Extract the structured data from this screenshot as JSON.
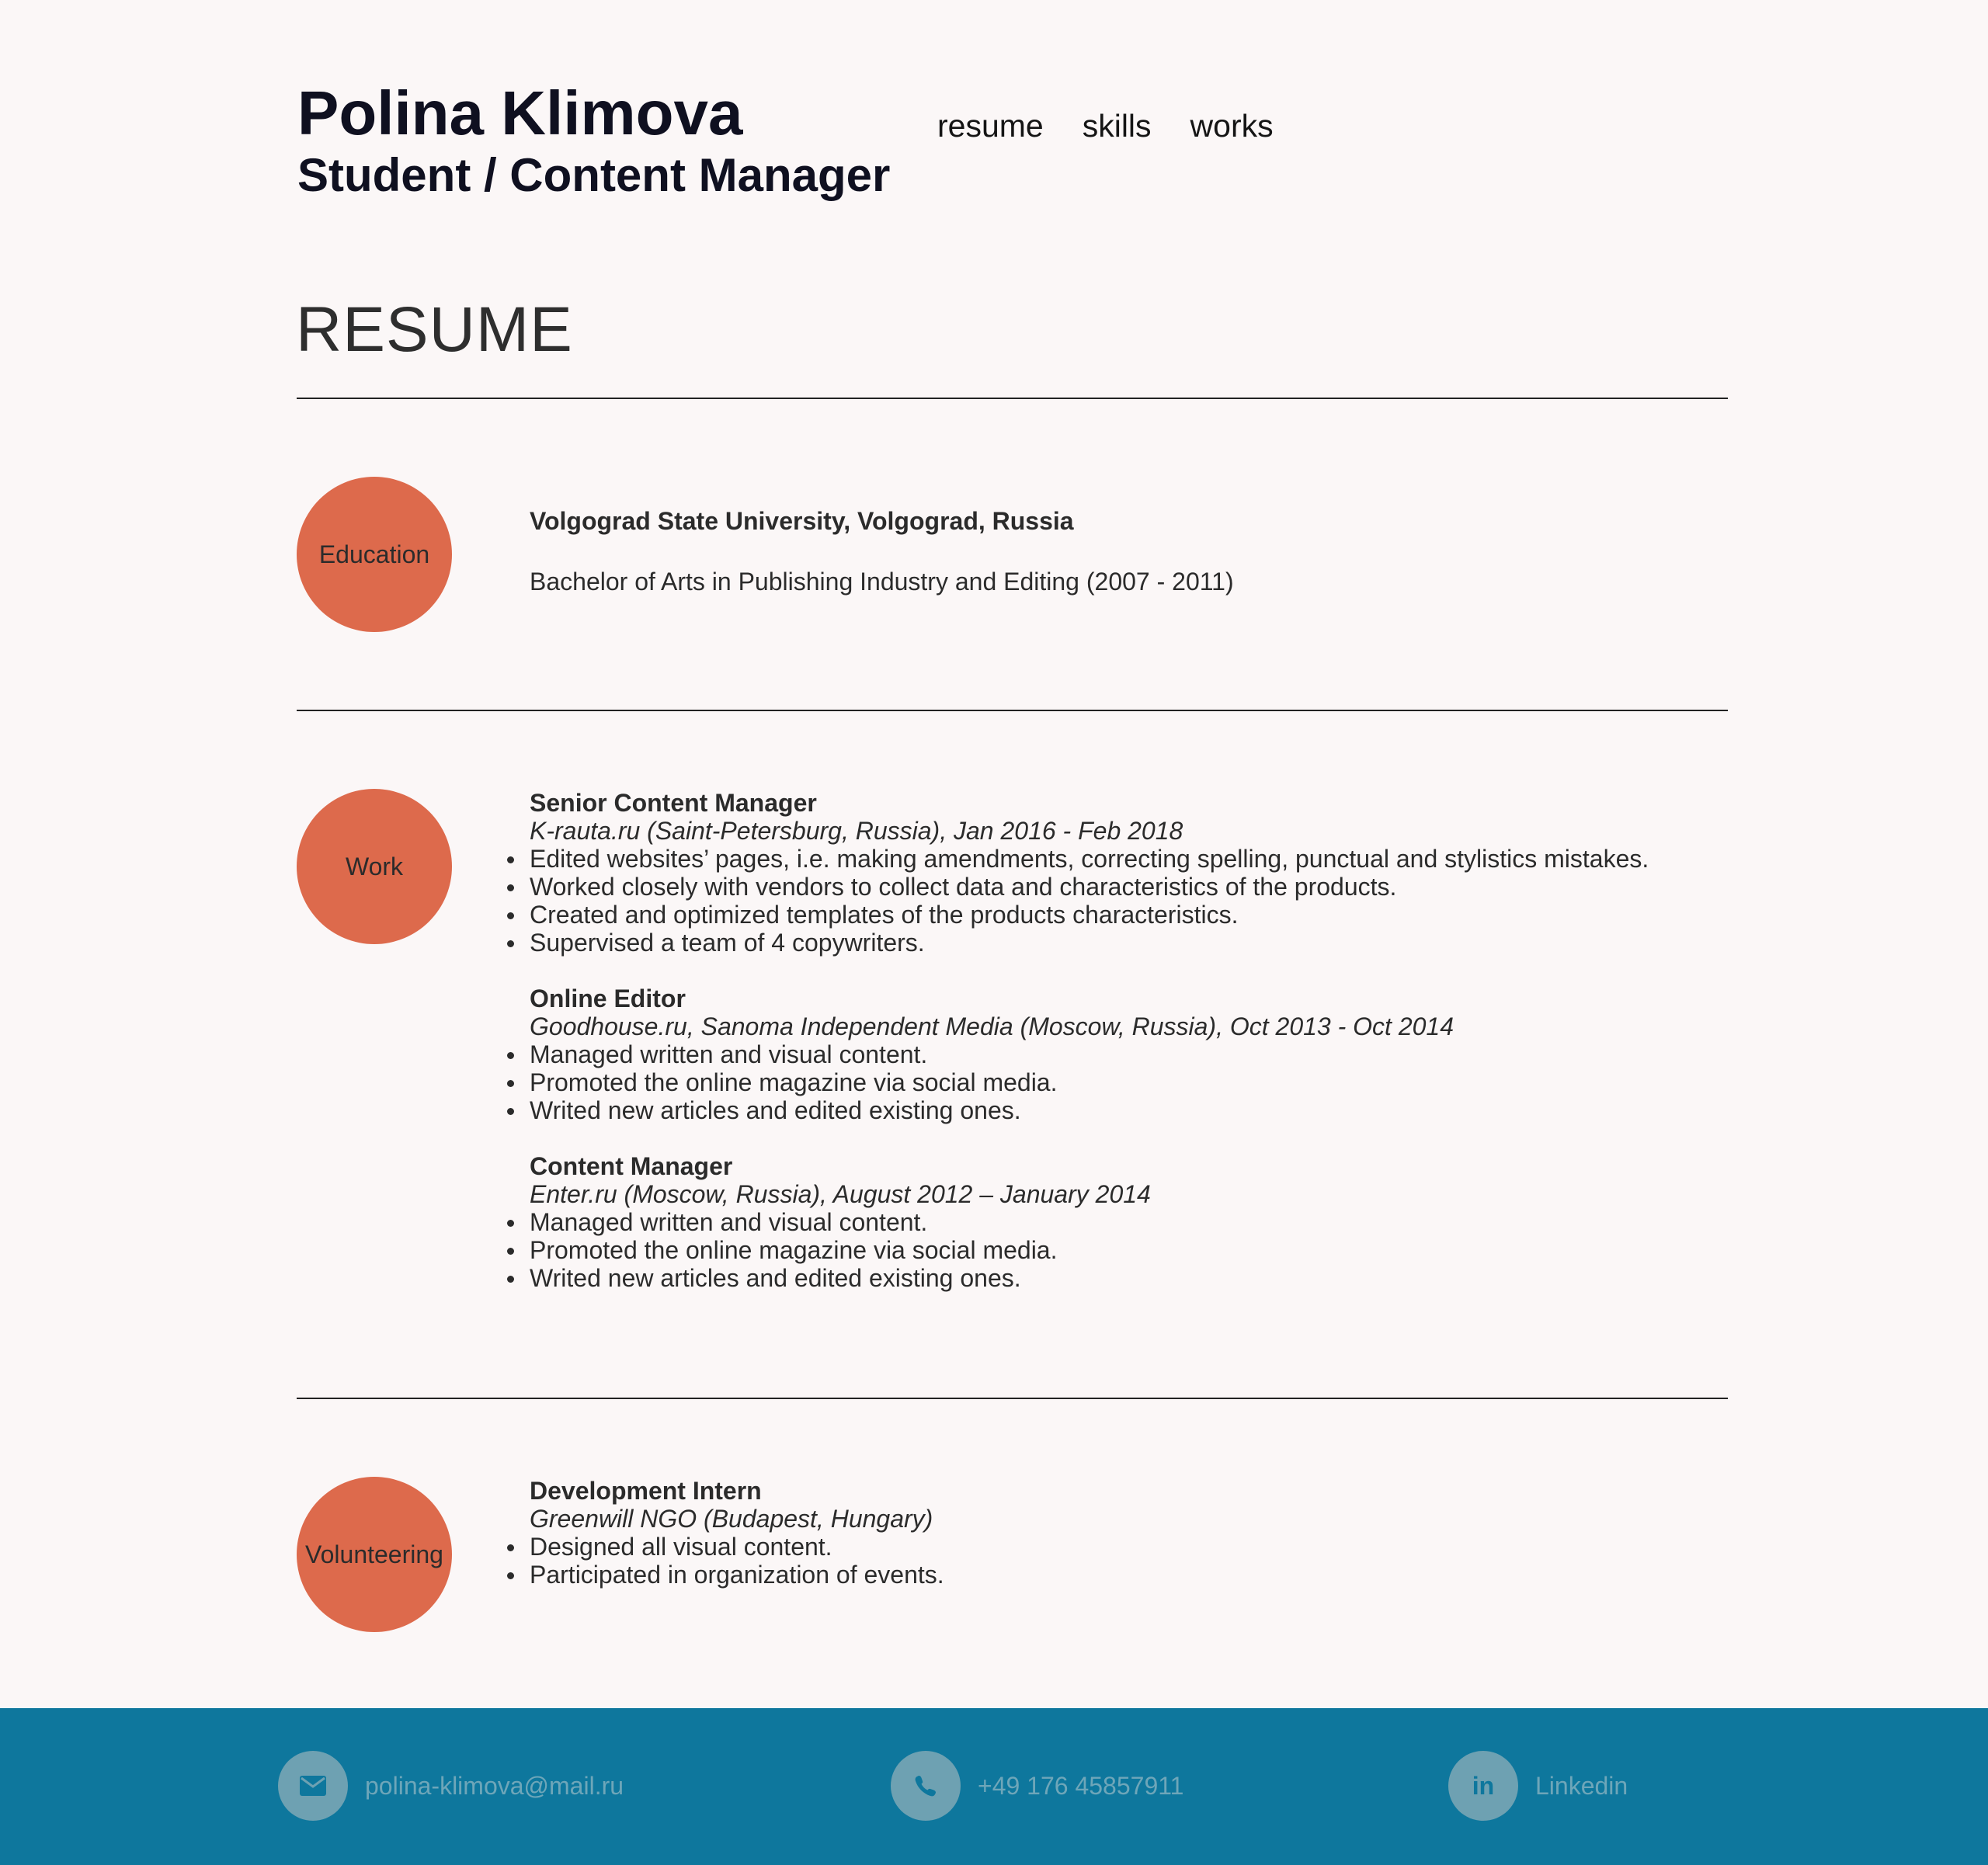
{
  "header": {
    "name": "Polina Klimova",
    "subtitle": "Student / Content Manager",
    "nav": [
      {
        "label": "resume"
      },
      {
        "label": "skills"
      },
      {
        "label": "works"
      }
    ]
  },
  "page_title": "RESUME",
  "education": {
    "badge": "Education",
    "school": "Volgograd State University, Volgograd, Russia",
    "degree": "Bachelor of Arts in Publishing Industry and Editing (2007 - 2011)"
  },
  "work": {
    "badge": "Work",
    "jobs": [
      {
        "title": "Senior Content Manager",
        "meta": "K-rauta.ru (Saint-Petersburg, Russia), Jan 2016 - Feb 2018",
        "bullets": [
          "Edited websites’ pages, i.e. making amendments, correcting spelling, punctual and stylistics mistakes.",
          "Worked closely with vendors to collect data and characteristics of the products.",
          "Created and optimized templates of the products characteristics.",
          "Supervised a team of 4 copywriters."
        ]
      },
      {
        "title": "Online Editor",
        "meta": "Goodhouse.ru, Sanoma Independent Media (Moscow, Russia), Oct 2013 - Oct 2014",
        "bullets": [
          "Managed written and visual content.",
          "Promoted the online magazine via social media.",
          "Writed new articles and edited existing ones."
        ]
      },
      {
        "title": "Content Manager",
        "meta": "Enter.ru (Moscow, Russia), August 2012 – January 2014",
        "bullets": [
          "Managed written and visual content.",
          "Promoted the online magazine via social media.",
          "Writed new articles and edited existing ones."
        ]
      }
    ]
  },
  "volunteering": {
    "badge": "Volunteering",
    "jobs": [
      {
        "title": "Development Intern",
        "meta": "Greenwill NGO (Budapest, Hungary)",
        "bullets": [
          "Designed all visual content.",
          "Participated in organization of events."
        ]
      }
    ]
  },
  "footer": {
    "email": {
      "icon": "envelope-icon",
      "text": "polina-klimova@mail.ru"
    },
    "phone": {
      "icon": "phone-icon",
      "text": "+49 176 45857911"
    },
    "linkedin": {
      "icon": "linkedin-icon",
      "glyph": "in",
      "text": "Linkedin"
    }
  },
  "colors": {
    "background": "#fbf7f7",
    "badge": "#dd6a4c",
    "footer": "#0e779d",
    "footer_icon": "#6ea1b2",
    "footer_text": "#6ea6b9"
  }
}
